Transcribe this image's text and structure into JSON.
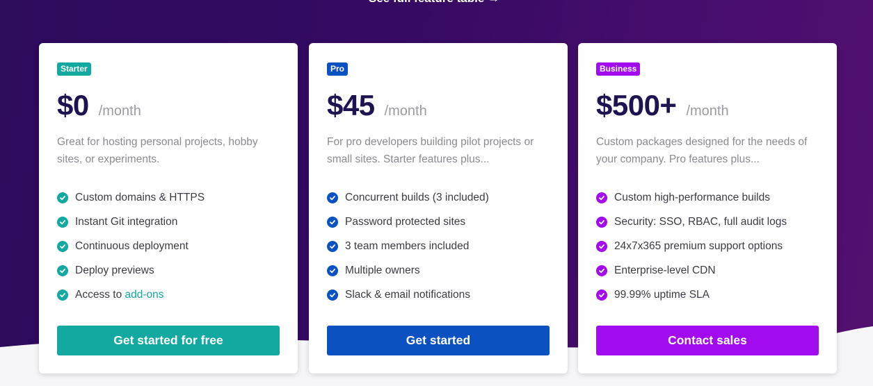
{
  "top_link": "See full feature table →",
  "colors": {
    "starter": "#14a9a0",
    "pro": "#0b51c2",
    "business": "#a20bf0"
  },
  "plans": [
    {
      "badge": "Starter",
      "price": "$0",
      "period": "/month",
      "description": "Great for hosting personal projects, hobby sites, or experiments.",
      "features": [
        "Custom domains & HTTPS",
        "Instant Git integration",
        "Continuous deployment",
        "Deploy previews"
      ],
      "last_feature_prefix": "Access to ",
      "last_feature_link": "add-ons",
      "cta": "Get started for free"
    },
    {
      "badge": "Pro",
      "price": "$45",
      "period": "/month",
      "description": "For pro developers building pilot projects or small sites. Starter features plus...",
      "features": [
        "Concurrent builds (3 included)",
        "Password protected sites",
        "3 team members included",
        "Multiple owners",
        "Slack & email notifications"
      ],
      "cta": "Get started"
    },
    {
      "badge": "Business",
      "price": "$500+",
      "period": "/month",
      "description": "Custom packages designed for the needs of your company. Pro features plus...",
      "features": [
        "Custom high-performance builds",
        "Security: SSO, RBAC, full audit logs",
        "24x7x365 premium support options",
        "Enterprise-level CDN",
        "99.99% uptime SLA"
      ],
      "cta": "Contact sales"
    }
  ]
}
